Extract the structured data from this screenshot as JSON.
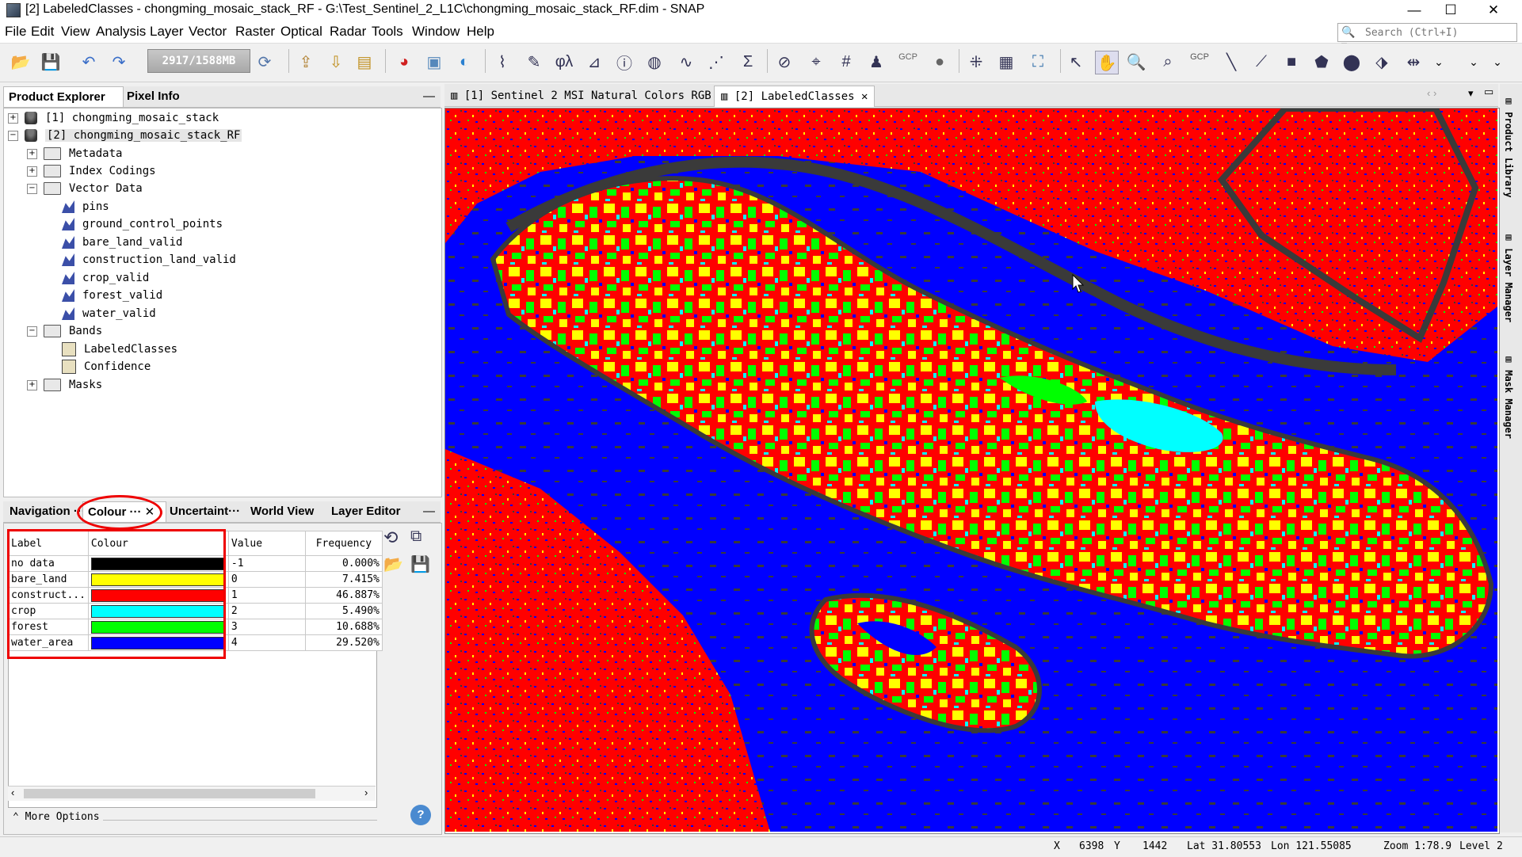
{
  "window": {
    "title": "[2] LabeledClasses - chongming_mosaic_stack_RF - G:\\Test_Sentinel_2_L1C\\chongming_mosaic_stack_RF.dim - SNAP",
    "minimize": "—",
    "maximize": "☐",
    "close": "✕"
  },
  "menu": [
    "File",
    "Edit",
    "View",
    "Analysis",
    "Layer",
    "Vector",
    "Raster",
    "Optical",
    "Radar",
    "Tools",
    "Window",
    "Help"
  ],
  "search": {
    "placeholder": "Search (Ctrl+I)"
  },
  "toolbar": {
    "memory": "2917/1588MB",
    "gcp1": "GCP",
    "gcp2": "GCP"
  },
  "left_top": {
    "tabs": [
      "Product Explorer",
      "Pixel Info"
    ],
    "tree": [
      {
        "label": "[1]  chongming_mosaic_stack",
        "icon": "database"
      },
      {
        "label": "[2]  chongming_mosaic_stack_RF",
        "icon": "database"
      },
      {
        "label": "Metadata",
        "icon": "folder"
      },
      {
        "label": "Index Codings",
        "icon": "folder"
      },
      {
        "label": "Vector Data",
        "icon": "folder"
      },
      {
        "label": "pins",
        "icon": "vector"
      },
      {
        "label": "ground_control_points",
        "icon": "vector"
      },
      {
        "label": "bare_land_valid",
        "icon": "vector"
      },
      {
        "label": "construction_land_valid",
        "icon": "vector"
      },
      {
        "label": "crop_valid",
        "icon": "vector"
      },
      {
        "label": "forest_valid",
        "icon": "vector"
      },
      {
        "label": "water_valid",
        "icon": "vector"
      },
      {
        "label": "Bands",
        "icon": "folder"
      },
      {
        "label": "LabeledClasses",
        "icon": "band"
      },
      {
        "label": "Confidence",
        "icon": "band"
      },
      {
        "label": "Masks",
        "icon": "folder"
      }
    ]
  },
  "left_bottom": {
    "tabs": [
      "Navigation ···",
      "Colour ···",
      "Uncertaint···",
      "World View",
      "Layer Editor"
    ],
    "columns": [
      "Label",
      "Colour",
      "Value",
      "Frequency"
    ],
    "rows": [
      {
        "label": "no data",
        "color": "#000000",
        "value": "-1",
        "freq": "0.000%"
      },
      {
        "label": "bare_land",
        "color": "#ffff00",
        "value": "0",
        "freq": "7.415%"
      },
      {
        "label": "construct...",
        "color": "#ff0000",
        "value": "1",
        "freq": "46.887%"
      },
      {
        "label": "crop",
        "color": "#00ffff",
        "value": "2",
        "freq": "5.490%"
      },
      {
        "label": "forest",
        "color": "#00ff00",
        "value": "3",
        "freq": "10.688%"
      },
      {
        "label": "water_area",
        "color": "#0000ff",
        "value": "4",
        "freq": "29.520%"
      }
    ],
    "more_options": "More Options"
  },
  "view_tabs": [
    "[1] Sentinel 2 MSI Natural Colors RGB",
    "[2] LabeledClasses"
  ],
  "right_dock": [
    "Product Library",
    "Layer Manager",
    "Mask Manager"
  ],
  "status": {
    "x_label": "X",
    "x": "6398",
    "y_label": "Y",
    "y": "1442",
    "lat": "Lat 31.80553",
    "lon": "Lon 121.55085",
    "zoom": "Zoom 1:78.9",
    "level": "Level 2"
  },
  "colors": {
    "water": "#0000ff",
    "construction": "#ff0000",
    "forest": "#00ff00",
    "bare": "#ffff00",
    "crop": "#00ffff",
    "nodata": "#3a3a3a",
    "highlight": "#e00000"
  }
}
